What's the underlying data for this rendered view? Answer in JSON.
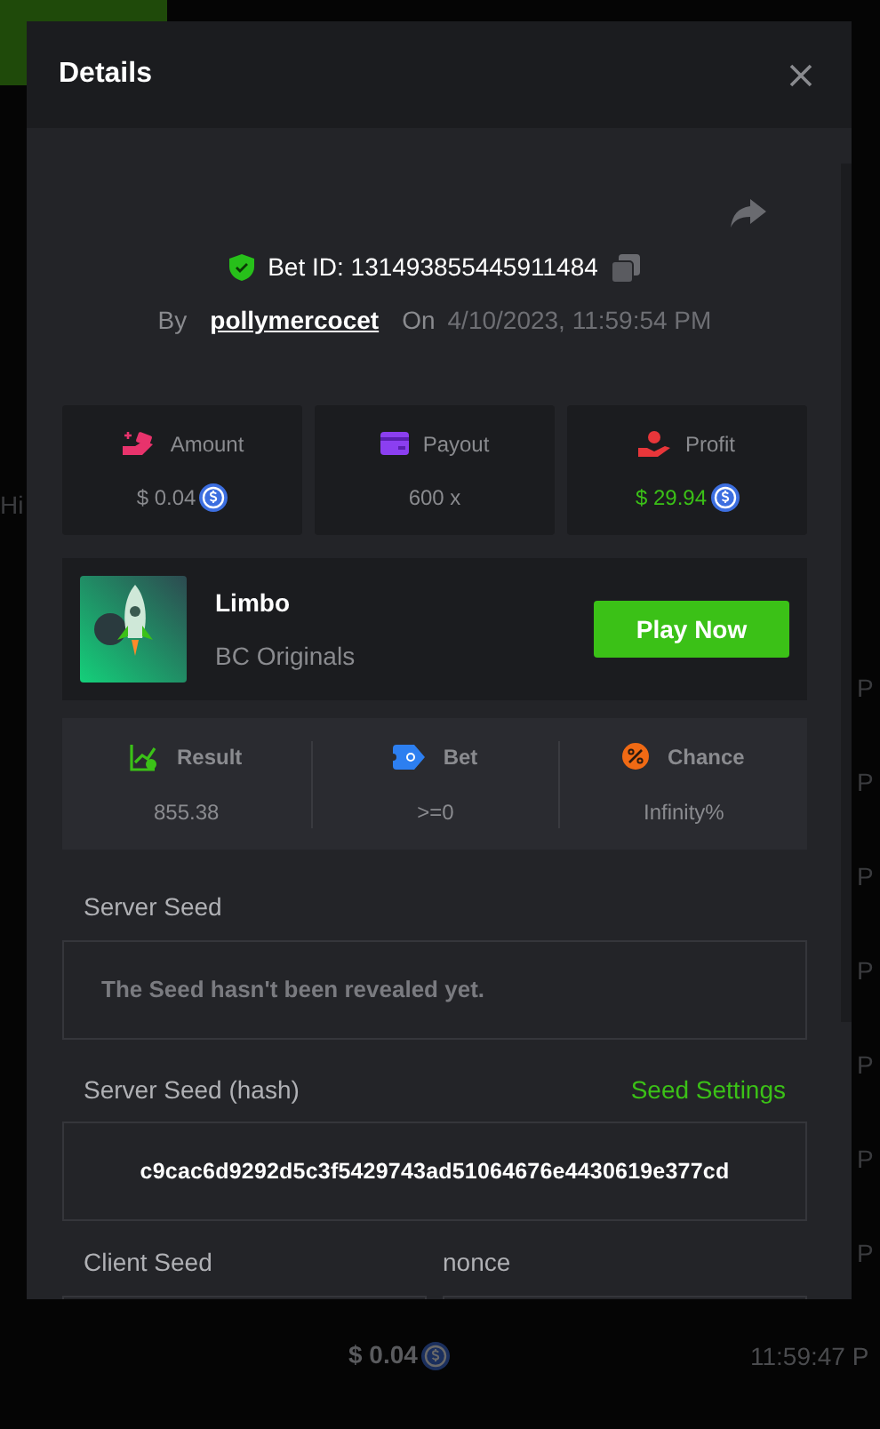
{
  "background": {
    "left_fragments": [
      "Hi"
    ],
    "right_fragments": [
      "P",
      "P",
      "P",
      "P",
      "P",
      "P",
      "P"
    ],
    "bottom_row": {
      "amount": "$ 0.04",
      "time": "11:59:47 P"
    }
  },
  "modal": {
    "title": "Details",
    "bet_id": "Bet ID: 131493855445911484",
    "by_label": "By",
    "user": "pollymercocet",
    "on_label": "On",
    "date": "4/10/2023, 11:59:54 PM",
    "stats": [
      {
        "kind": "amount",
        "label": "Amount",
        "value": "$ 0.04",
        "coin": true,
        "positive": false
      },
      {
        "kind": "payout",
        "label": "Payout",
        "value": "600 x",
        "coin": false,
        "positive": false
      },
      {
        "kind": "profit",
        "label": "Profit",
        "value": "$ 29.94",
        "coin": true,
        "positive": true
      }
    ],
    "game": {
      "name": "Limbo",
      "provider": "BC Originals",
      "button": "Play Now"
    },
    "results": [
      {
        "kind": "result",
        "label": "Result",
        "value": "855.38"
      },
      {
        "kind": "bet",
        "label": "Bet",
        "value": ">=0"
      },
      {
        "kind": "chance",
        "label": "Chance",
        "value": "Infinity%"
      }
    ],
    "server_seed": {
      "label": "Server Seed",
      "value": "The Seed hasn't been revealed yet."
    },
    "hash": {
      "label": "Server Seed (hash)",
      "link": "Seed Settings",
      "value": "c9cac6d9292d5c3f5429743ad51064676e4430619e377cd"
    },
    "client_seed": {
      "label": "Client Seed"
    },
    "nonce": {
      "label": "nonce"
    }
  }
}
